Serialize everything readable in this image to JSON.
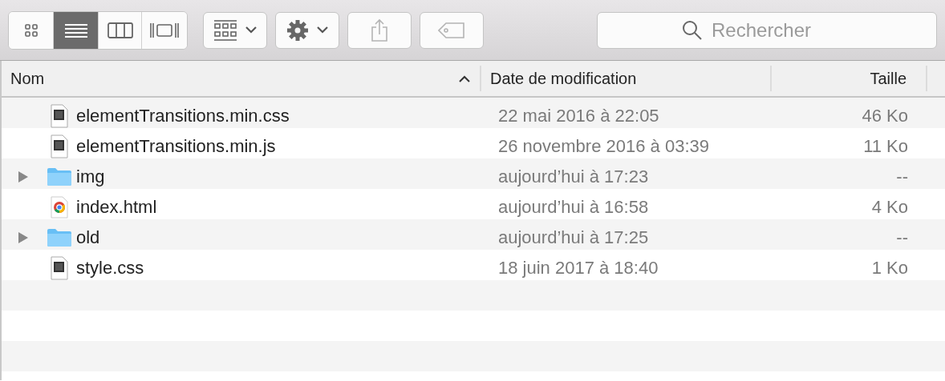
{
  "toolbar": {
    "view_modes": [
      {
        "kind": "icons",
        "selected": false
      },
      {
        "kind": "list",
        "selected": true
      },
      {
        "kind": "columns",
        "selected": false
      },
      {
        "kind": "coverflow",
        "selected": false
      }
    ],
    "buttons": [
      {
        "kind": "arrange"
      },
      {
        "kind": "action"
      },
      {
        "kind": "share"
      },
      {
        "kind": "tag"
      }
    ],
    "search": {
      "placeholder": "Rechercher"
    }
  },
  "table": {
    "columns": [
      {
        "label": "Nom",
        "sorted": true
      },
      {
        "label": "Date de modification",
        "sorted": false
      },
      {
        "label": "Taille",
        "sorted": false
      }
    ],
    "rows": [
      {
        "kind": "css",
        "name": "elementTransitions.min.css",
        "date": "22 mai 2016 à 22:05",
        "size": "46 Ko"
      },
      {
        "kind": "js",
        "name": "elementTransitions.min.js",
        "date": "26 novembre 2016 à 03:39",
        "size": "11 Ko"
      },
      {
        "kind": "folder",
        "name": "img",
        "date": "aujourd’hui à 17:23",
        "size": "--"
      },
      {
        "kind": "chrome",
        "name": "index.html",
        "date": "aujourd’hui à 16:58",
        "size": "4 Ko"
      },
      {
        "kind": "folder",
        "name": "old",
        "date": "aujourd’hui à 17:25",
        "size": "--"
      },
      {
        "kind": "css",
        "name": "style.css",
        "date": "18 juin 2017 à 18:40",
        "size": "1 Ko"
      }
    ]
  }
}
